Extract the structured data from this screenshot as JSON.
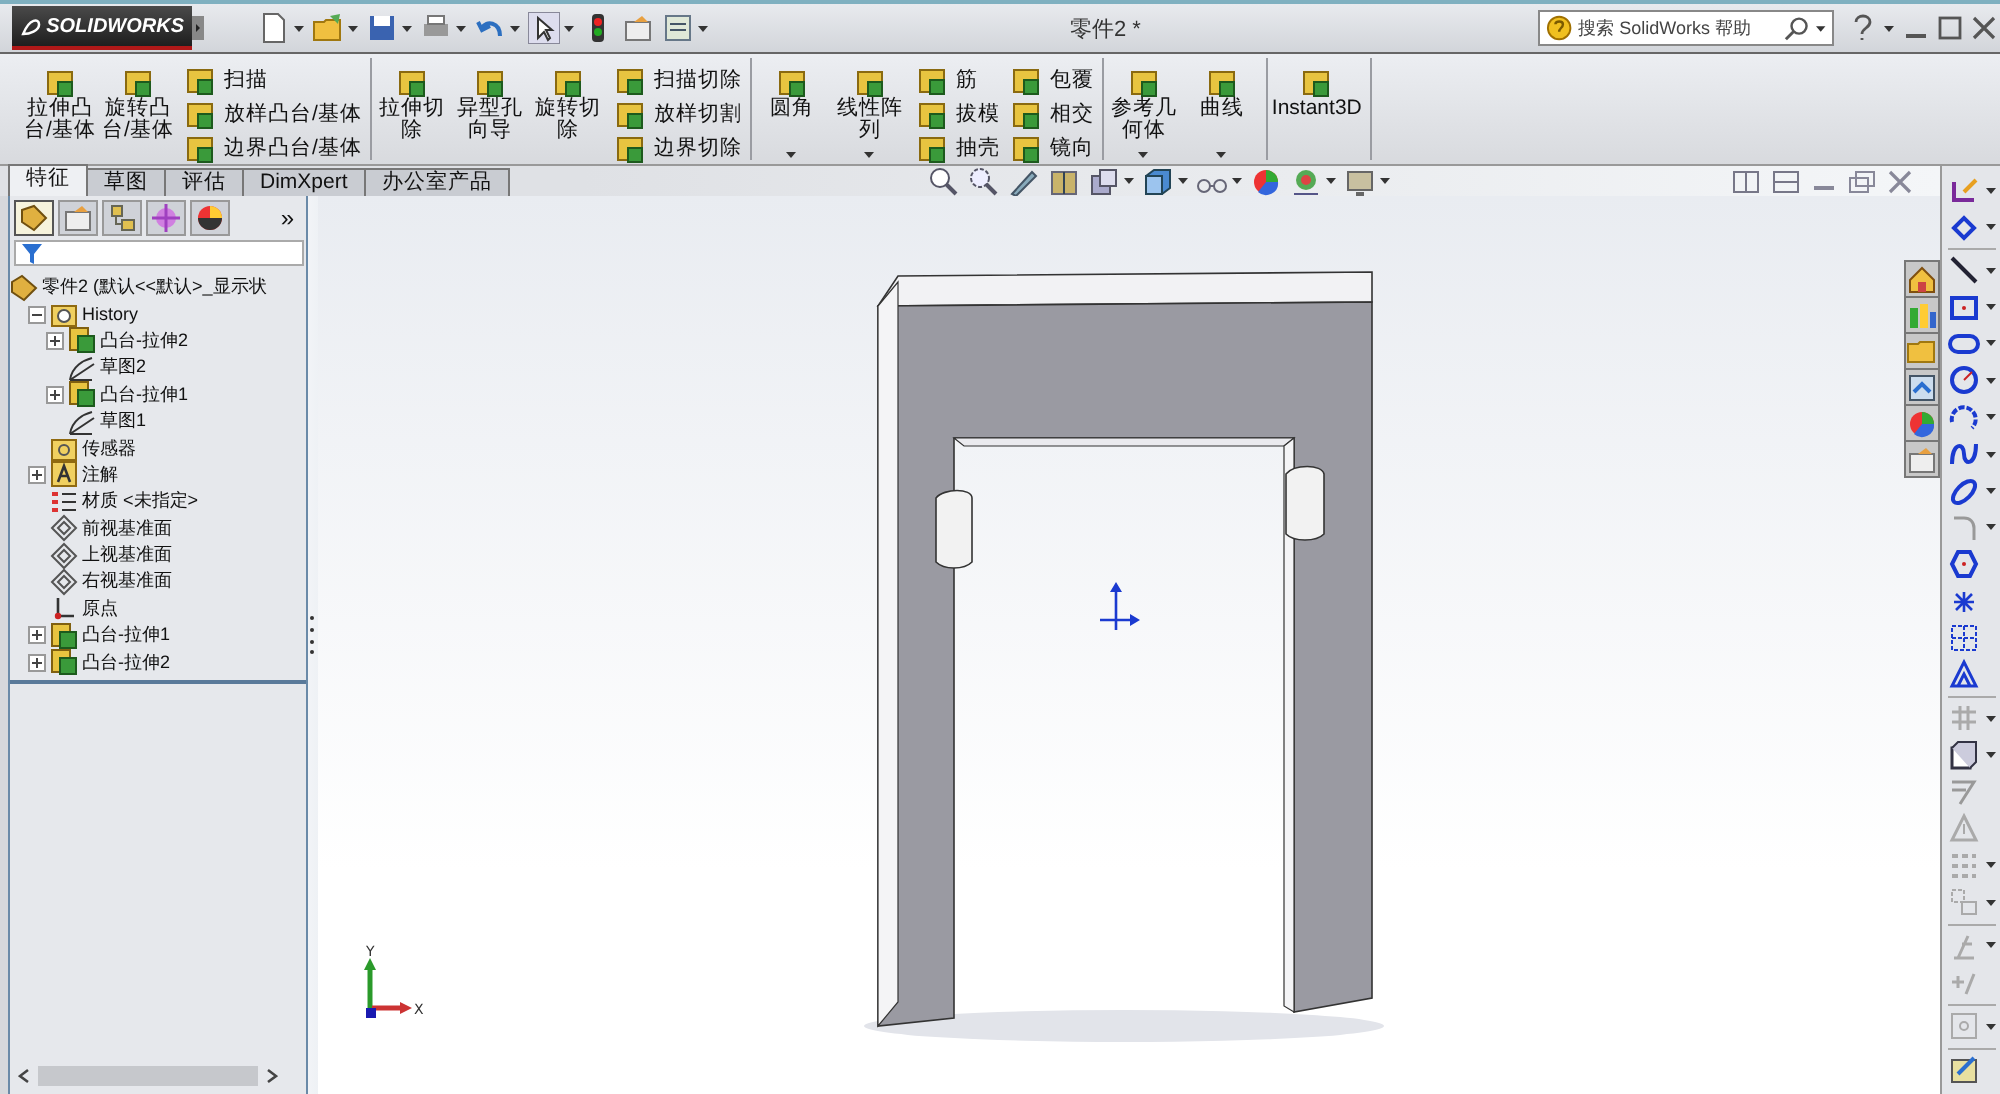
{
  "window": {
    "logo": "SOLIDWORKS",
    "title": "零件2 *",
    "search": {
      "placeholder": "搜索 SolidWorks 帮助"
    }
  },
  "ribbon": {
    "groups": [
      {
        "items": [
          {
            "kind": "large",
            "label": "拉伸凸台/基体",
            "dropdown": false
          },
          {
            "kind": "large",
            "label": "旋转凸台/基体",
            "dropdown": false
          },
          {
            "kind": "stack",
            "labels": [
              "扫描",
              "放样凸台/基体",
              "边界凸台/基体"
            ]
          }
        ]
      },
      {
        "items": [
          {
            "kind": "large",
            "label": "拉伸切除",
            "dropdown": false
          },
          {
            "kind": "large",
            "label": "异型孔向导",
            "dropdown": false
          },
          {
            "kind": "large",
            "label": "旋转切除",
            "dropdown": false
          },
          {
            "kind": "stack",
            "labels": [
              "扫描切除",
              "放样切割",
              "边界切除"
            ]
          }
        ]
      },
      {
        "items": [
          {
            "kind": "large",
            "label": "圆角",
            "dropdown": true
          },
          {
            "kind": "large",
            "label": "线性阵列",
            "dropdown": true
          },
          {
            "kind": "stack",
            "labels": [
              "筋",
              "拔模",
              "抽壳"
            ]
          },
          {
            "kind": "stack",
            "labels": [
              "包覆",
              "相交",
              "镜向"
            ]
          }
        ]
      },
      {
        "items": [
          {
            "kind": "large",
            "label": "参考几何体",
            "dropdown": true
          },
          {
            "kind": "large",
            "label": "曲线",
            "dropdown": true
          }
        ]
      },
      {
        "items": [
          {
            "kind": "large",
            "label": "Instant3D",
            "dropdown": false
          }
        ]
      }
    ]
  },
  "command_tabs": [
    {
      "label": "特征",
      "selected": true
    },
    {
      "label": "草图",
      "selected": false
    },
    {
      "label": "评估",
      "selected": false
    },
    {
      "label": "DimXpert",
      "selected": false
    },
    {
      "label": "办公室产品",
      "selected": false
    }
  ],
  "panel_tabs": {
    "tabs": [
      {
        "selected": true
      },
      {
        "selected": false
      },
      {
        "selected": false
      },
      {
        "selected": false
      },
      {
        "selected": false
      }
    ],
    "more": "»"
  },
  "tree": [
    {
      "kind": "part",
      "label": "零件2 (默认<<默认>_显示状",
      "children": [
        {
          "kind": "history",
          "label": "History",
          "expanded": true,
          "children": [
            {
              "kind": "feature",
              "label": "凸台-拉伸2",
              "expanded": false
            },
            {
              "kind": "sketch",
              "label": "草图2"
            },
            {
              "kind": "feature",
              "label": "凸台-拉伸1",
              "expanded": false
            },
            {
              "kind": "sketch",
              "label": "草图1"
            }
          ]
        },
        {
          "kind": "sensor",
          "label": "传感器"
        },
        {
          "kind": "annotation",
          "label": "注解",
          "expanded": false
        },
        {
          "kind": "material",
          "label": "材质 <未指定>"
        },
        {
          "kind": "plane",
          "label": "前视基准面"
        },
        {
          "kind": "plane",
          "label": "上视基准面"
        },
        {
          "kind": "plane",
          "label": "右视基准面"
        },
        {
          "kind": "origin",
          "label": "原点"
        },
        {
          "kind": "feature",
          "label": "凸台-拉伸1",
          "expanded": false
        },
        {
          "kind": "feature",
          "label": "凸台-拉伸2",
          "expanded": false
        }
      ]
    }
  ],
  "graphics": {
    "triad": {
      "x_label": "X",
      "y_label": "Y"
    }
  }
}
